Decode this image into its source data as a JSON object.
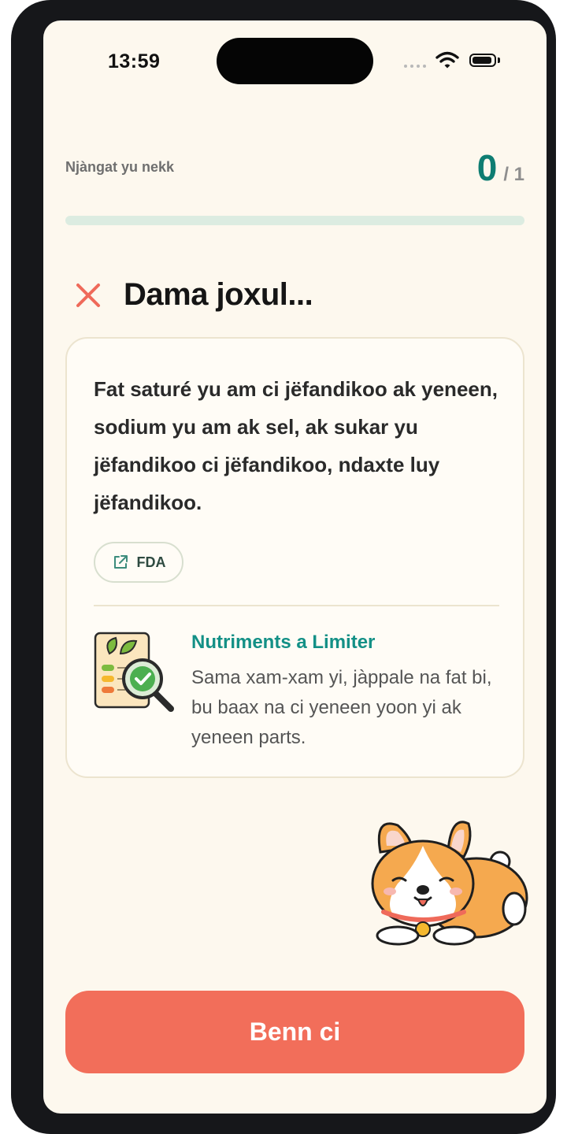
{
  "status_bar": {
    "time": "13:59"
  },
  "quiz": {
    "progress_label": "Njàngat yu nekk",
    "score": "0",
    "total": "/ 1",
    "progress_fraction": 0
  },
  "result": {
    "title": "Dama joxul..."
  },
  "card": {
    "fact": "Fat saturé yu am ci jëfandikoo ak yeneen, sodium yu am ak sel, ak sukar yu jëfandikoo ci jëfandikoo, ndaxte luy jëfandikoo.",
    "source": "FDA",
    "info_title": "Nutriments a Limiter",
    "info_text": "Sama xam-xam yi, jàppale na fat bi, bu baax na ci yeneen yoon yi ak yeneen parts."
  },
  "actions": {
    "continue_label": "Benn ci"
  },
  "colors": {
    "accent": "#0e7d72",
    "error": "#f26e5a",
    "background": "#fdf8ee"
  }
}
